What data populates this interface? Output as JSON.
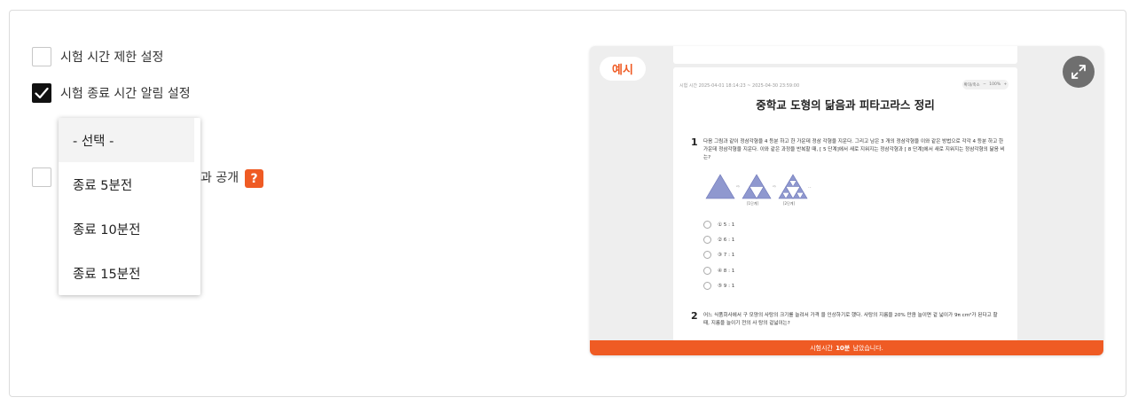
{
  "options": [
    {
      "label": "시험 시간 제한 설정",
      "checked": false
    },
    {
      "label": "시험 종료 시간 알림 설정",
      "checked": true
    },
    {
      "label": "과 공개",
      "checked": false
    }
  ],
  "help_label": "?",
  "dropdown": {
    "items": [
      "- 선택 -",
      "종료 5분전",
      "종료 10분전",
      "종료 15분전"
    ]
  },
  "preview": {
    "badge": "예시",
    "time_range": "시험 시간  2025-04-01 18:14:23 ~ 2025-04-30 23:59:00",
    "zoom": {
      "label": "확대/축소",
      "minus": "−",
      "value": "100%",
      "plus": "+"
    },
    "title": "중학교 도형의 닮음과 피타고라스 정리",
    "questions": [
      {
        "number": "1",
        "text": "다음 그림과 같이 정삼각형을 4 등분 하고 한 가운데 정삼 각형을 지운다. 그리고 남은 3 개의 정삼각형을 이와 같은 방법으로 각각 4 등분 하고 한 가운데 정삼각형을 지운다. 이와 같은 과정을 반복할 때, [ 5 단계]에서 새로 지워지는 정삼각형과 [ 8 단계]에서 새로 지워지는 정삼각형의 닮음 비는?",
        "figure_captions": [
          "[1단계]",
          "[2단계]"
        ],
        "choices": [
          "① 5 : 1",
          "② 6 : 1",
          "③ 7 : 1",
          "④ 8 : 1",
          "⑤ 9 : 1"
        ]
      },
      {
        "number": "2",
        "text": "어느 식품회사에서 구 모양의 사탕의 크기를 늘려서 가격 을 인상하기로 했다. 사탕의 지름을 20% 만큼 늘이면 겉 넓이가 9π cm²가 된다고 할 때, 지름을 늘이기 전의 사 탕의 겉넓이는?"
      }
    ],
    "footer": {
      "prefix": "시험시간",
      "highlight": "10분",
      "suffix": "남았습니다."
    }
  },
  "colors": {
    "accent": "#ef5b24",
    "checkbox_checked": "#111111",
    "figure_fill": "#8f98cf"
  }
}
